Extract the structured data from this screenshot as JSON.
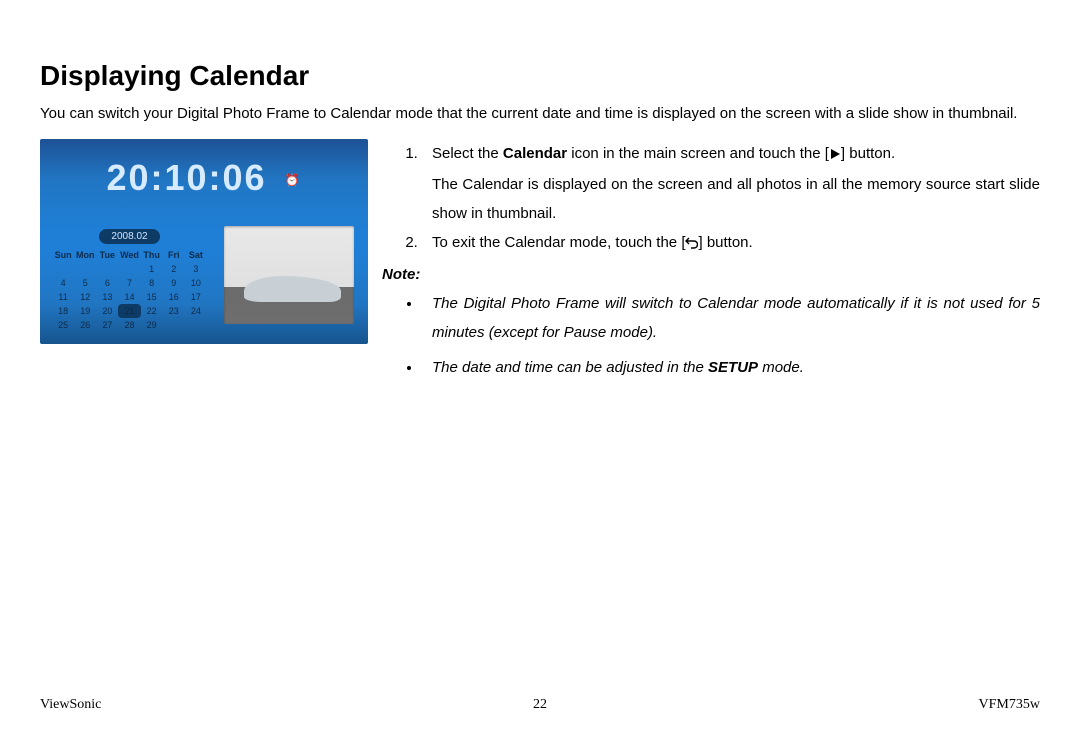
{
  "title": "Displaying Calendar",
  "intro": "You can switch your Digital Photo Frame to Calendar mode that the current date and time is displayed on the screen with a slide show in thumbnail.",
  "figure": {
    "time": "20:10:06",
    "month_label": "2008.02",
    "day_headers": [
      "Sun",
      "Mon",
      "Tue",
      "Wed",
      "Thu",
      "Fri",
      "Sat"
    ],
    "rows": [
      [
        "",
        "",
        "",
        "",
        "1",
        "2",
        "3"
      ],
      [
        "4",
        "5",
        "6",
        "7",
        "8",
        "9",
        "10"
      ],
      [
        "11",
        "12",
        "13",
        "14",
        "15",
        "16",
        "17"
      ],
      [
        "18",
        "19",
        "20",
        "21",
        "22",
        "23",
        "24"
      ],
      [
        "25",
        "26",
        "27",
        "28",
        "29",
        "",
        ""
      ]
    ],
    "selected_day": "21"
  },
  "step1": {
    "prefix": "Select the ",
    "bold": "Calendar",
    "mid": " icon in the main screen and touch the [",
    "after_icon": "] button.",
    "cont": "The Calendar is displayed on the screen and all photos in all the memory source start slide show in thumbnail."
  },
  "step2": {
    "prefix": "To exit the Calendar mode, touch the [",
    "after_icon": "] button."
  },
  "note_heading": "Note:",
  "note1": {
    "text": "The Digital Photo Frame will switch to Calendar mode automatically if it is not used for 5 minutes (except for Pause mode)."
  },
  "note2": {
    "prefix": "The date and time can be adjusted in the ",
    "bold": "SETUP",
    "suffix": " mode."
  },
  "footer": {
    "left": "ViewSonic",
    "center": "22",
    "right": "VFM735w"
  }
}
